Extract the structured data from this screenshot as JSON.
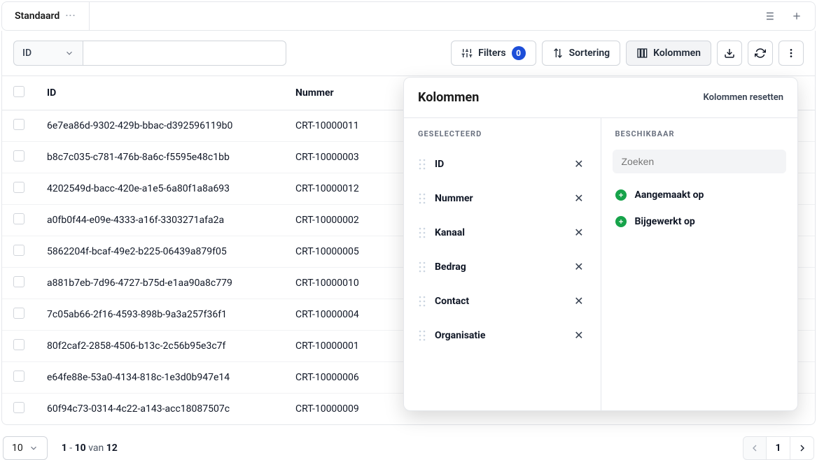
{
  "tabs": {
    "active": "Standaard"
  },
  "toolbar": {
    "filter_field": "ID",
    "filters_label": "Filters",
    "filters_count": "0",
    "sort_label": "Sortering",
    "columns_label": "Kolommen"
  },
  "table": {
    "headers": {
      "id": "ID",
      "nummer": "Nummer"
    },
    "rows": [
      {
        "id": "6e7ea86d-9302-429b-bbac-d392596119b0",
        "nummer": "CRT-10000011"
      },
      {
        "id": "b8c7c035-c781-476b-8a6c-f5595e48c1bb",
        "nummer": "CRT-10000003"
      },
      {
        "id": "4202549d-bacc-420e-a1e5-6a80f1a8a693",
        "nummer": "CRT-10000012"
      },
      {
        "id": "a0fb0f44-e09e-4333-a16f-3303271afa2a",
        "nummer": "CRT-10000002"
      },
      {
        "id": "5862204f-bcaf-49e2-b225-06439a879f05",
        "nummer": "CRT-10000005"
      },
      {
        "id": "a881b7eb-7d96-4727-b75d-e1aa90a8c779",
        "nummer": "CRT-10000010"
      },
      {
        "id": "7c05ab66-2f16-4593-898b-9a3a257f36f1",
        "nummer": "CRT-10000004"
      },
      {
        "id": "80f2caf2-2858-4506-b13c-2c56b95e3c7f",
        "nummer": "CRT-10000001"
      },
      {
        "id": "e64fe88e-53a0-4134-818c-1e3d0b947e14",
        "nummer": "CRT-10000006"
      },
      {
        "id": "60f94c73-0314-4c22-a143-acc18087507c",
        "nummer": "CRT-10000009"
      }
    ]
  },
  "footer": {
    "page_size": "10",
    "range_from": "1",
    "range_to": "10",
    "van": "van",
    "total": "12",
    "current_page": "1"
  },
  "columns_popover": {
    "title": "Kolommen",
    "reset": "Kolommen resetten",
    "selected_header": "GESELECTEERD",
    "available_header": "BESCHIKBAAR",
    "search_placeholder": "Zoeken",
    "selected": [
      "ID",
      "Nummer",
      "Kanaal",
      "Bedrag",
      "Contact",
      "Organisatie"
    ],
    "available": [
      "Aangemaakt op",
      "Bijgewerkt op"
    ]
  }
}
